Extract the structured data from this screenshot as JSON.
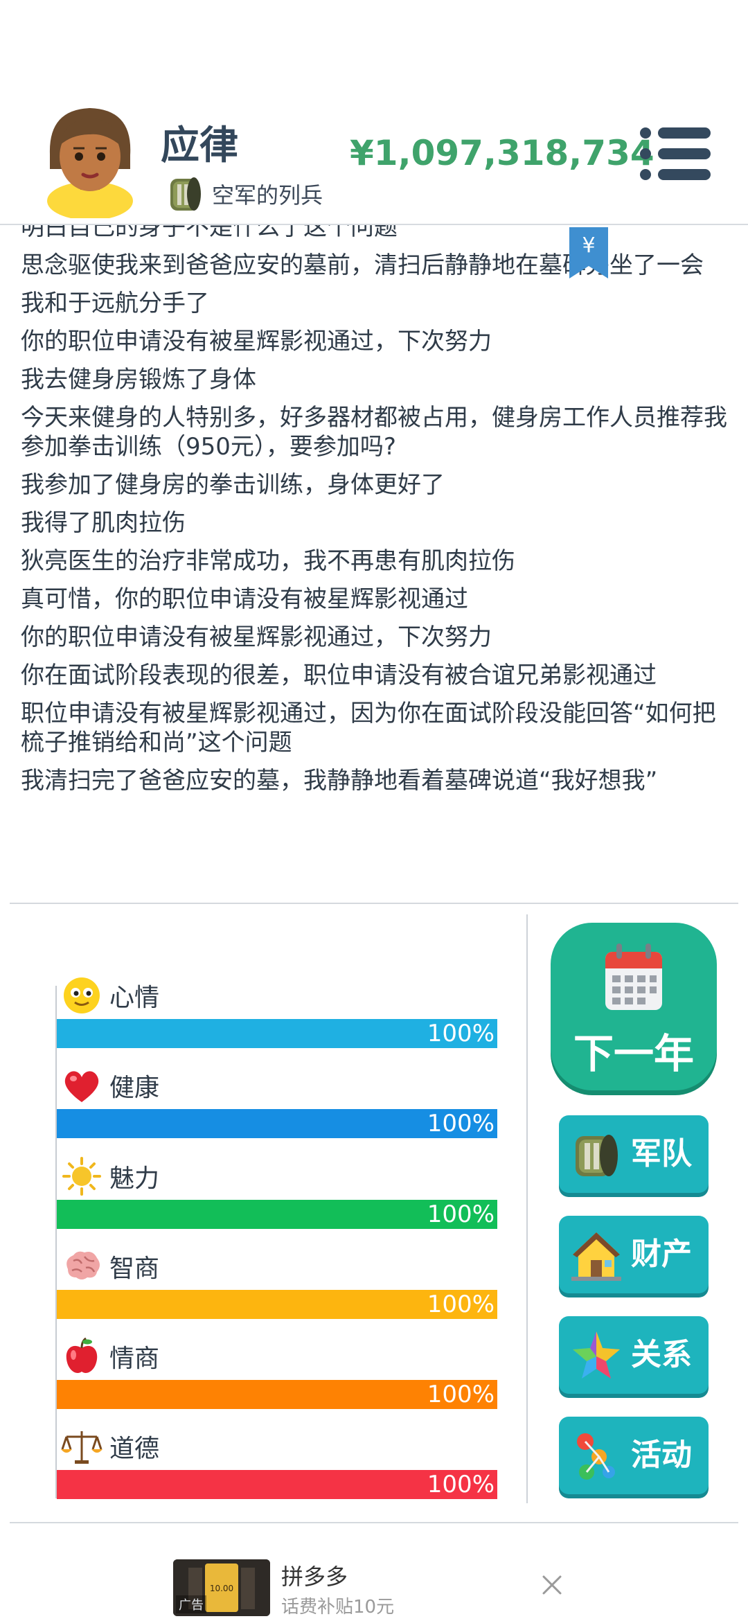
{
  "player": {
    "name": "应律",
    "title_badge": "空军的列兵",
    "money": "¥1,097,318,734"
  },
  "log": {
    "lines": [
      "明白自己的身子不是什么了这个问题",
      "思念驱使我来到爸爸应安的墓前，清扫后静静地在墓碑旁坐了一会",
      "我和于远航分手了",
      "你的职位申请没有被星辉影视通过，下次努力",
      "我去健身房锻炼了身体",
      "今天来健身的人特别多，好多器材都被占用，健身房工作人员推荐我参加拳击训练（950元），要参加吗?",
      "我参加了健身房的拳击训练，身体更好了",
      "我得了肌肉拉伤",
      "狄亮医生的治疗非常成功，我不再患有肌肉拉伤",
      "真可惜，你的职位申请没有被星辉影视通过",
      "你的职位申请没有被星辉影视通过，下次努力",
      "你在面试阶段表现的很差，职位申请没有被合谊兄弟影视通过",
      "职位申请没有被星辉影视通过，因为你在面试阶段没能回答“如何把梳子推销给和尚”这个问题",
      "我清扫完了爸爸应安的墓，我静静地看着墓碑说道“我好想我”"
    ],
    "bookmark_symbol": "¥"
  },
  "stats": [
    {
      "label": "心情",
      "value": 100,
      "display": "100%",
      "color": "#1fb0e2",
      "icon": "smiley-face-icon"
    },
    {
      "label": "健康",
      "value": 100,
      "display": "100%",
      "color": "#168ee3",
      "icon": "heart-icon"
    },
    {
      "label": "魅力",
      "value": 100,
      "display": "100%",
      "color": "#12be58",
      "icon": "sun-icon"
    },
    {
      "label": "智商",
      "value": 100,
      "display": "100%",
      "color": "#fdb50f",
      "icon": "brain-icon"
    },
    {
      "label": "情商",
      "value": 100,
      "display": "100%",
      "color": "#fe8203",
      "icon": "apple-icon"
    },
    {
      "label": "道德",
      "value": 100,
      "display": "100%",
      "color": "#f53345",
      "icon": "scales-icon"
    }
  ],
  "actions": {
    "next_year": "下一年",
    "army": "军队",
    "property": "财产",
    "relations": "关系",
    "activities": "活动"
  },
  "ad": {
    "title": "拼多多",
    "subtitle": "话费补贴10元",
    "tag": "广告",
    "thumb_text": "10.00"
  },
  "colors": {
    "money": "#3fa36b",
    "next_year_button": "#20b491",
    "side_button": "#1eb4bd"
  }
}
